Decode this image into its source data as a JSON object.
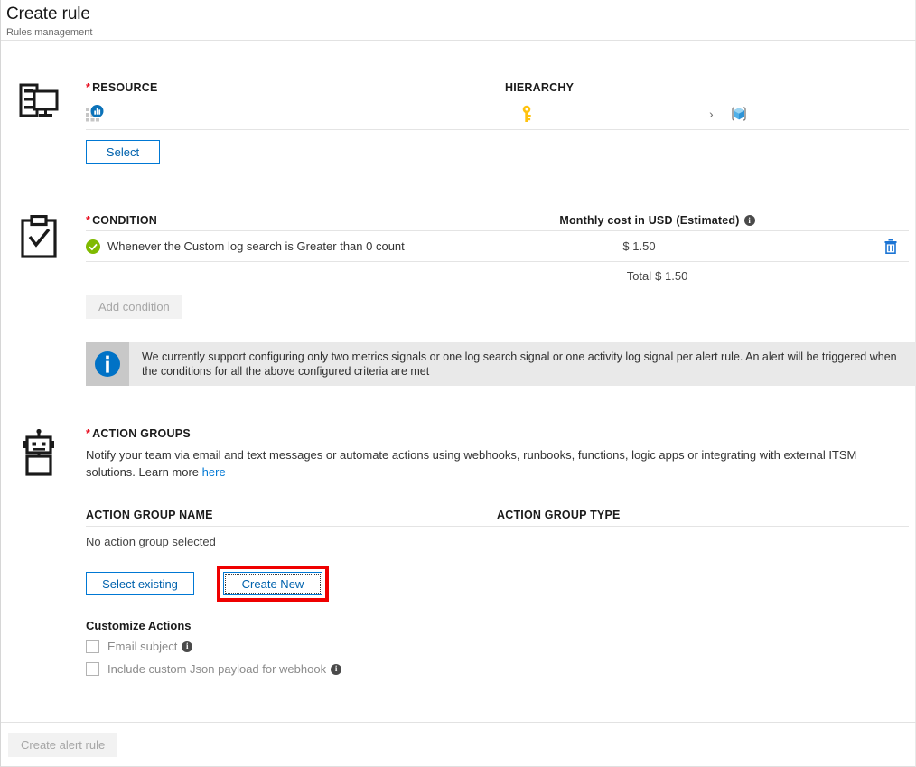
{
  "header": {
    "title": "Create rule",
    "subtitle": "Rules management"
  },
  "resource": {
    "icon": "server-monitor-icon",
    "label": "RESOURCE",
    "required_marker": "*",
    "hierarchy_header": "HIERARCHY",
    "resource_item_icon": "log-analytics-workspace-icon",
    "hierarchy_subscription_icon": "key-icon",
    "hierarchy_separator_icon": "chevron-right-icon",
    "hierarchy_resource_group_icon": "resource-group-cube-icon",
    "select_button": "Select"
  },
  "condition": {
    "icon": "clipboard-check-icon",
    "label": "CONDITION",
    "required_marker": "*",
    "cost_header": "Monthly cost in USD (Estimated)",
    "cost_header_info_icon": "info-icon",
    "rows": [
      {
        "status_icon": "green-check-icon",
        "text": "Whenever the Custom log search is Greater than 0 count",
        "cost": "$ 1.50",
        "delete_icon": "trash-icon"
      }
    ],
    "total_label": "Total",
    "total_value": "$ 1.50",
    "add_condition_button": "Add condition",
    "banner": {
      "icon": "info-circle-icon",
      "text": "We currently support configuring only two metrics signals or one log search signal or one activity log signal per alert rule. An alert will be triggered when the conditions for all the above configured criteria are met"
    }
  },
  "action_groups": {
    "icon": "robot-icon",
    "label": "ACTION GROUPS",
    "required_marker": "*",
    "description": "Notify your team via email and text messages or automate actions using webhooks, runbooks, functions, logic apps or integrating with external ITSM solutions.",
    "learn_more_prefix": "Learn more",
    "learn_more_link": "here",
    "table": {
      "columns": [
        "ACTION GROUP NAME",
        "ACTION GROUP TYPE"
      ],
      "empty_message": "No action group selected"
    },
    "select_existing_button": "Select existing",
    "create_new_button": "Create New",
    "highlight_color": "#ef0000"
  },
  "customize_actions": {
    "title": "Customize Actions",
    "checkboxes": [
      {
        "label": "Email subject",
        "checked": false,
        "info_icon": "info-icon"
      },
      {
        "label": "Include custom Json payload for webhook",
        "checked": false,
        "info_icon": "info-icon"
      }
    ]
  },
  "footer": {
    "create_alert_rule_button": "Create alert rule",
    "disabled": true
  },
  "colors": {
    "accent": "#0078d4",
    "link": "#0078d4",
    "required": "#e81123",
    "success": "#7fba00",
    "highlight": "#ef0000",
    "key_yellow": "#ffc20e",
    "cube_blue": "#50b0e8"
  }
}
